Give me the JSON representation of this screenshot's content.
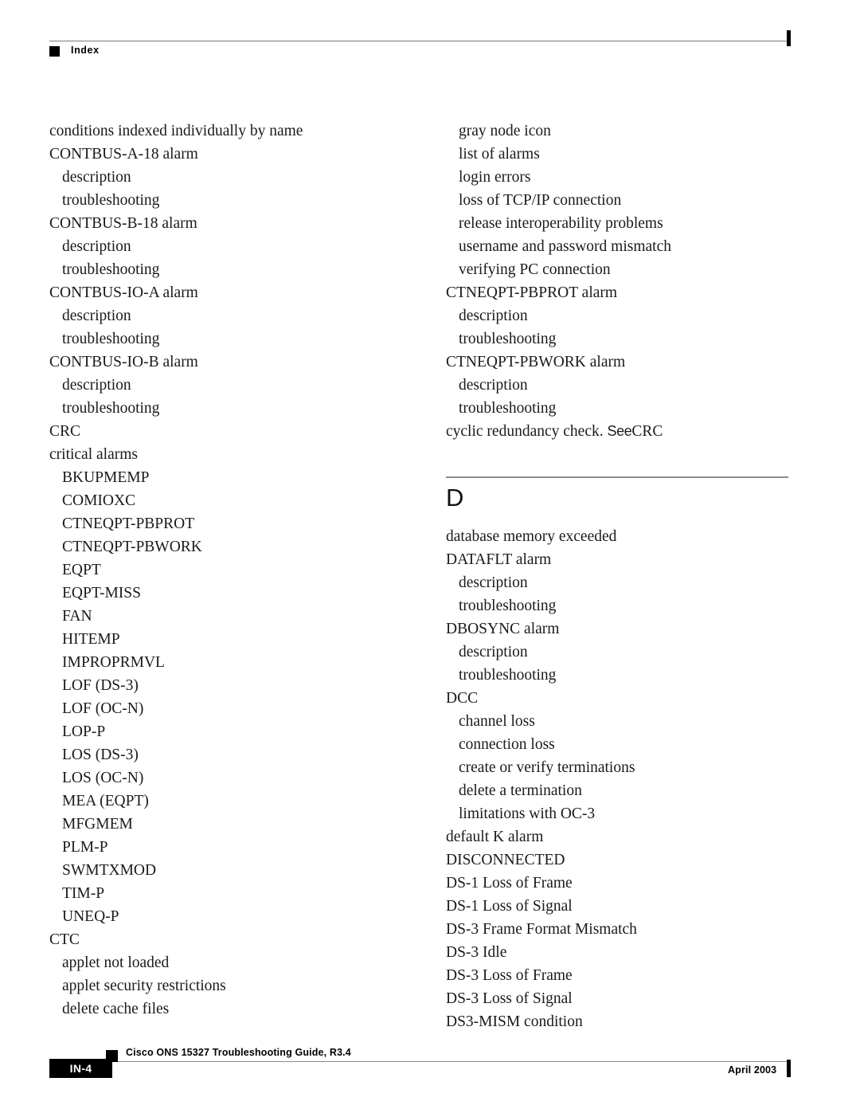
{
  "header": {
    "running_head": "Index"
  },
  "columns": {
    "left": [
      {
        "level": 1,
        "text": "conditions indexed individually by name"
      },
      {
        "level": 1,
        "text": "CONTBUS-A-18 alarm"
      },
      {
        "level": 2,
        "text": "description"
      },
      {
        "level": 2,
        "text": "troubleshooting"
      },
      {
        "level": 1,
        "text": "CONTBUS-B-18 alarm"
      },
      {
        "level": 2,
        "text": "description"
      },
      {
        "level": 2,
        "text": "troubleshooting"
      },
      {
        "level": 1,
        "text": "CONTBUS-IO-A alarm"
      },
      {
        "level": 2,
        "text": "description"
      },
      {
        "level": 2,
        "text": "troubleshooting"
      },
      {
        "level": 1,
        "text": "CONTBUS-IO-B alarm"
      },
      {
        "level": 2,
        "text": "description"
      },
      {
        "level": 2,
        "text": "troubleshooting"
      },
      {
        "level": 1,
        "text": "CRC"
      },
      {
        "level": 1,
        "text": "critical alarms"
      },
      {
        "level": 2,
        "text": "BKUPMEMP"
      },
      {
        "level": 2,
        "text": "COMIOXC"
      },
      {
        "level": 2,
        "text": "CTNEQPT-PBPROT"
      },
      {
        "level": 2,
        "text": "CTNEQPT-PBWORK"
      },
      {
        "level": 2,
        "text": "EQPT"
      },
      {
        "level": 2,
        "text": "EQPT-MISS"
      },
      {
        "level": 2,
        "text": "FAN"
      },
      {
        "level": 2,
        "text": "HITEMP"
      },
      {
        "level": 2,
        "text": "IMPROPRMVL"
      },
      {
        "level": 2,
        "text": "LOF (DS-3)"
      },
      {
        "level": 2,
        "text": "LOF (OC-N)"
      },
      {
        "level": 2,
        "text": "LOP-P"
      },
      {
        "level": 2,
        "text": "LOS (DS-3)"
      },
      {
        "level": 2,
        "text": "LOS (OC-N)"
      },
      {
        "level": 2,
        "text": "MEA (EQPT)"
      },
      {
        "level": 2,
        "text": "MFGMEM"
      },
      {
        "level": 2,
        "text": "PLM-P"
      },
      {
        "level": 2,
        "text": "SWMTXMOD"
      },
      {
        "level": 2,
        "text": "TIM-P"
      },
      {
        "level": 2,
        "text": "UNEQ-P"
      },
      {
        "level": 1,
        "text": "CTC"
      },
      {
        "level": 2,
        "text": "applet not loaded"
      },
      {
        "level": 2,
        "text": "applet security restrictions"
      },
      {
        "level": 2,
        "text": "delete cache files"
      }
    ],
    "right_before_section": [
      {
        "level": 2,
        "text": "gray node icon"
      },
      {
        "level": 2,
        "text": "list of alarms"
      },
      {
        "level": 2,
        "text": "login errors"
      },
      {
        "level": 2,
        "text": "loss of TCP/IP connection"
      },
      {
        "level": 2,
        "text": "release interoperability problems"
      },
      {
        "level": 2,
        "text": "username and password mismatch"
      },
      {
        "level": 2,
        "text": "verifying PC connection"
      },
      {
        "level": 1,
        "text": "CTNEQPT-PBPROT alarm"
      },
      {
        "level": 2,
        "text": "description"
      },
      {
        "level": 2,
        "text": "troubleshooting"
      },
      {
        "level": 1,
        "text": "CTNEQPT-PBWORK alarm"
      },
      {
        "level": 2,
        "text": "description"
      },
      {
        "level": 2,
        "text": "troubleshooting"
      }
    ],
    "cross_reference": {
      "lead": "cyclic redundancy check. ",
      "see": "See",
      "target": "CRC"
    },
    "section_letter": "D",
    "right_after_section": [
      {
        "level": 1,
        "text": "database memory exceeded"
      },
      {
        "level": 1,
        "text": "DATAFLT alarm"
      },
      {
        "level": 2,
        "text": "description"
      },
      {
        "level": 2,
        "text": "troubleshooting"
      },
      {
        "level": 1,
        "text": "DBOSYNC alarm"
      },
      {
        "level": 2,
        "text": "description"
      },
      {
        "level": 2,
        "text": "troubleshooting"
      },
      {
        "level": 1,
        "text": "DCC"
      },
      {
        "level": 2,
        "text": "channel loss"
      },
      {
        "level": 2,
        "text": "connection loss"
      },
      {
        "level": 2,
        "text": "create or verify terminations"
      },
      {
        "level": 2,
        "text": "delete a termination"
      },
      {
        "level": 2,
        "text": "limitations with OC-3"
      },
      {
        "level": 1,
        "text": "default K alarm"
      },
      {
        "level": 1,
        "text": "DISCONNECTED"
      },
      {
        "level": 1,
        "text": "DS-1 Loss of Frame"
      },
      {
        "level": 1,
        "text": "DS-1 Loss of Signal"
      },
      {
        "level": 1,
        "text": "DS-3 Frame Format Mismatch"
      },
      {
        "level": 1,
        "text": "DS-3 Idle"
      },
      {
        "level": 1,
        "text": "DS-3 Loss of Frame"
      },
      {
        "level": 1,
        "text": "DS-3 Loss of Signal"
      },
      {
        "level": 1,
        "text": "DS3-MISM condition"
      }
    ]
  },
  "footer": {
    "page_number": "IN-4",
    "document_title": "Cisco ONS 15327 Troubleshooting Guide, R3.4",
    "date": "April 2003"
  }
}
